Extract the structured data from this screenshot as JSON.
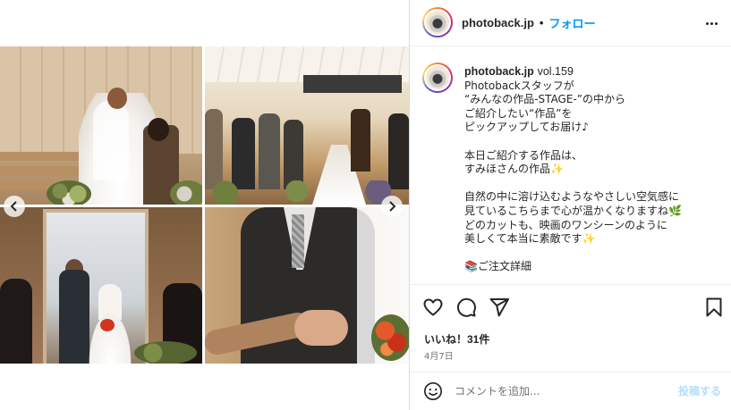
{
  "header": {
    "username": "photoback.jp",
    "separator": "•",
    "follow_label": "フォロー"
  },
  "caption": {
    "username": "photoback.jp",
    "first_line": "vol.159",
    "body": "Photobackスタッフが\n“みんなの作品-STAGE-”の中から\nご紹介したい“作品”を\nピックアップしてお届け♪\n\n本日ご紹介する作品は、\nすみほさんの作品✨\n\n自然の中に溶け込むようなやさしい空気感に\n見ているこちらまで心が温かくなりますね🌿\nどのカットも、映画のワンシーンのように\n美しくて本当に素敵です✨\n\n📚ご注文詳細"
  },
  "engagement": {
    "likes": "いいね！31件",
    "date": "4月7日"
  },
  "comment": {
    "placeholder": "コメントを追加...",
    "post_label": "投稿する"
  },
  "media": {
    "prev_icon": "chevron-left-icon",
    "next_icon": "chevron-right-icon"
  },
  "icons": {
    "like": "heart-icon",
    "comment": "comment-icon",
    "share": "send-icon",
    "save": "bookmark-icon",
    "emoji": "emoji-icon",
    "more": "more-options-icon"
  },
  "colors": {
    "accent": "#0095f6",
    "post_disabled": "#b2dffc",
    "muted": "#737373"
  }
}
